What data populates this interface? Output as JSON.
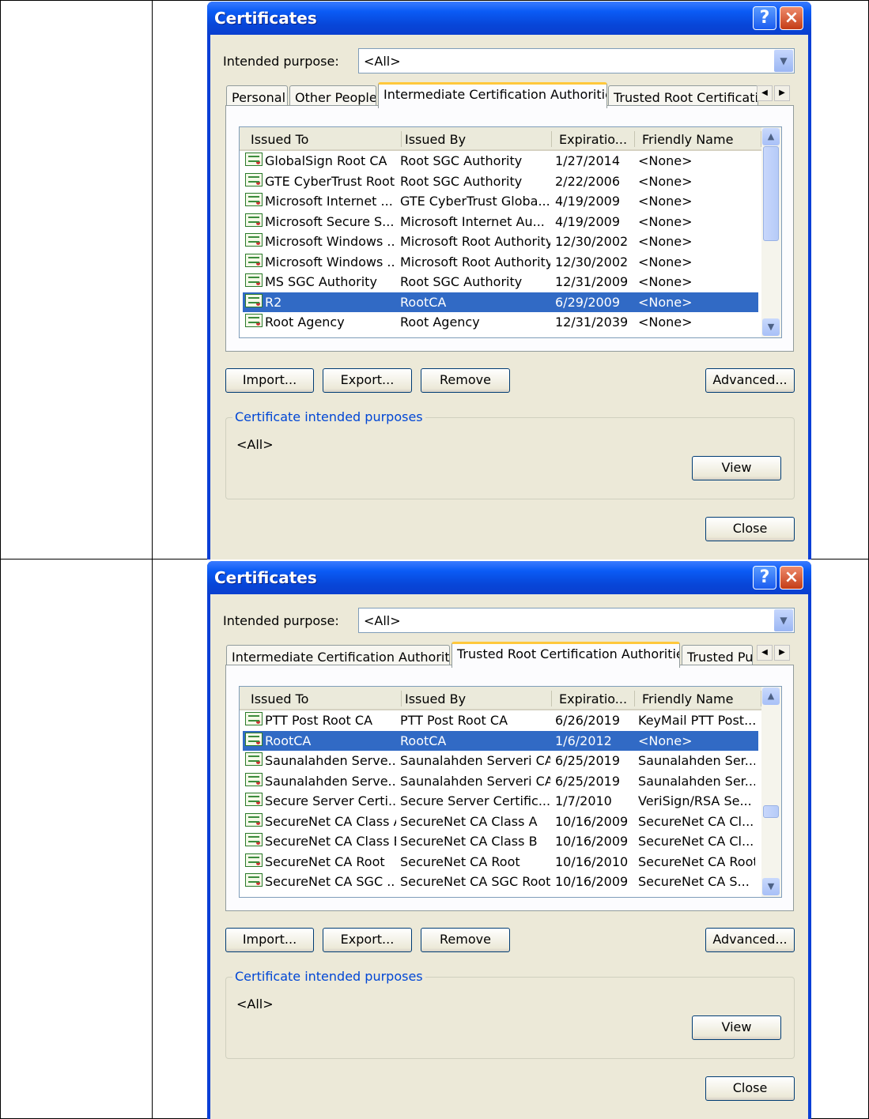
{
  "dialogs": [
    {
      "title": "Certificates",
      "help_label": "?",
      "close_glyph": "×",
      "intended_purpose_label": "Intended purpose:",
      "intended_purpose_value": "<All>",
      "tabs": [
        {
          "label": "Personal",
          "active": false
        },
        {
          "label": "Other People",
          "active": false
        },
        {
          "label": "Intermediate Certification Authorities",
          "active": true
        },
        {
          "label": "Trusted Root Certification Authorities",
          "active": false
        }
      ],
      "columns": [
        "Issued To",
        "Issued By",
        "Expiratio...",
        "Friendly Name"
      ],
      "rows": [
        {
          "issued_to": "GlobalSign Root CA",
          "issued_by": "Root SGC Authority",
          "expiration": "1/27/2014",
          "friendly_name": "<None>",
          "selected": false
        },
        {
          "issued_to": "GTE CyberTrust Root",
          "issued_by": "Root SGC Authority",
          "expiration": "2/22/2006",
          "friendly_name": "<None>",
          "selected": false
        },
        {
          "issued_to": "Microsoft Internet ...",
          "issued_by": "GTE CyberTrust Globa...",
          "expiration": "4/19/2009",
          "friendly_name": "<None>",
          "selected": false
        },
        {
          "issued_to": "Microsoft Secure S...",
          "issued_by": "Microsoft Internet Au...",
          "expiration": "4/19/2009",
          "friendly_name": "<None>",
          "selected": false
        },
        {
          "issued_to": "Microsoft Windows ...",
          "issued_by": "Microsoft Root Authority",
          "expiration": "12/30/2002",
          "friendly_name": "<None>",
          "selected": false
        },
        {
          "issued_to": "Microsoft Windows ...",
          "issued_by": "Microsoft Root Authority",
          "expiration": "12/30/2002",
          "friendly_name": "<None>",
          "selected": false
        },
        {
          "issued_to": "MS SGC Authority",
          "issued_by": "Root SGC Authority",
          "expiration": "12/31/2009",
          "friendly_name": "<None>",
          "selected": false
        },
        {
          "issued_to": "R2",
          "issued_by": "RootCA",
          "expiration": "6/29/2009",
          "friendly_name": "<None>",
          "selected": true
        },
        {
          "issued_to": "Root Agency",
          "issued_by": "Root Agency",
          "expiration": "12/31/2039",
          "friendly_name": "<None>",
          "selected": false
        }
      ],
      "buttons": {
        "import": "Import...",
        "export": "Export...",
        "remove": "Remove",
        "advanced": "Advanced...",
        "view": "View",
        "close": "Close"
      },
      "purposes_group_label": "Certificate intended purposes",
      "purposes_value": "<All>"
    },
    {
      "title": "Certificates",
      "help_label": "?",
      "close_glyph": "×",
      "intended_purpose_label": "Intended purpose:",
      "intended_purpose_value": "<All>",
      "tabs": [
        {
          "label": "Intermediate Certification Authorities",
          "active": false
        },
        {
          "label": "Trusted Root Certification Authorities",
          "active": true
        },
        {
          "label": "Trusted Publ",
          "active": false
        }
      ],
      "columns": [
        "Issued To",
        "Issued By",
        "Expiratio...",
        "Friendly Name"
      ],
      "rows": [
        {
          "issued_to": "PTT Post Root CA",
          "issued_by": "PTT Post Root CA",
          "expiration": "6/26/2019",
          "friendly_name": "KeyMail PTT Post...",
          "selected": false
        },
        {
          "issued_to": "RootCA",
          "issued_by": "RootCA",
          "expiration": "1/6/2012",
          "friendly_name": "<None>",
          "selected": true
        },
        {
          "issued_to": "Saunalahden Serve...",
          "issued_by": "Saunalahden Serveri CA",
          "expiration": "6/25/2019",
          "friendly_name": "Saunalahden Ser...",
          "selected": false
        },
        {
          "issued_to": "Saunalahden Serve...",
          "issued_by": "Saunalahden Serveri CA",
          "expiration": "6/25/2019",
          "friendly_name": "Saunalahden Ser...",
          "selected": false
        },
        {
          "issued_to": "Secure Server Certi...",
          "issued_by": "Secure Server Certific...",
          "expiration": "1/7/2010",
          "friendly_name": "VeriSign/RSA Se...",
          "selected": false
        },
        {
          "issued_to": "SecureNet CA Class A",
          "issued_by": "SecureNet CA Class A",
          "expiration": "10/16/2009",
          "friendly_name": "SecureNet CA Cl...",
          "selected": false
        },
        {
          "issued_to": "SecureNet CA Class B",
          "issued_by": "SecureNet CA Class B",
          "expiration": "10/16/2009",
          "friendly_name": "SecureNet CA Cl...",
          "selected": false
        },
        {
          "issued_to": "SecureNet CA Root",
          "issued_by": "SecureNet CA Root",
          "expiration": "10/16/2010",
          "friendly_name": "SecureNet CA Root",
          "selected": false
        },
        {
          "issued_to": "SecureNet CA SGC ...",
          "issued_by": "SecureNet CA SGC Root",
          "expiration": "10/16/2009",
          "friendly_name": "SecureNet CA S...",
          "selected": false
        }
      ],
      "buttons": {
        "import": "Import...",
        "export": "Export...",
        "remove": "Remove",
        "advanced": "Advanced...",
        "view": "View",
        "close": "Close"
      },
      "purposes_group_label": "Certificate intended purposes",
      "purposes_value": "<All>"
    }
  ]
}
